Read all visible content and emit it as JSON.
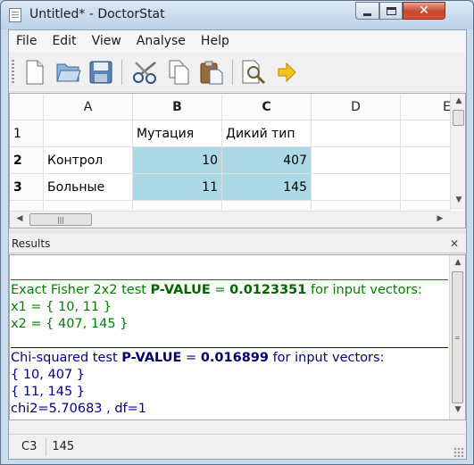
{
  "window": {
    "title": "Untitled* - DoctorStat",
    "close_glyph": "✕"
  },
  "menu": [
    "File",
    "Edit",
    "View",
    "Analyse",
    "Help"
  ],
  "toolbar": {
    "icons": [
      "new-document-icon",
      "open-folder-icon",
      "save-disk-icon",
      "cut-scissors-icon",
      "copy-icon",
      "paste-icon",
      "find-magnifier-icon",
      "run-arrow-icon"
    ]
  },
  "sheet": {
    "columns": [
      "A",
      "B",
      "C",
      "D",
      "E"
    ],
    "rows": [
      {
        "header": "1",
        "cells": [
          "",
          "Мутация",
          "Дикий тип",
          ""
        ]
      },
      {
        "header": "2",
        "cells": [
          "Контрол",
          "10",
          "407",
          ""
        ]
      },
      {
        "header": "3",
        "cells": [
          "Больные",
          "11",
          "145",
          ""
        ]
      }
    ],
    "selected_fill": "#add8e6"
  },
  "results": {
    "title": "Results",
    "fisher": {
      "prefix": "Exact Fisher 2x2 test ",
      "pvalue_label": "P-VALUE",
      "equals": " = ",
      "pvalue": "0.0123351",
      "suffix": " for input vectors:",
      "line2": "x1 = { 10, 11 }",
      "line3": "x2 = { 407, 145 }"
    },
    "chi": {
      "prefix": "Chi-squared test ",
      "pvalue_label": "P-VALUE",
      "equals": " = ",
      "pvalue": "0.016899",
      "suffix": " for input vectors:",
      "line2": "{ 10, 407 }",
      "line3": "{ 11, 145 }",
      "line4": "chi2=5.70683 , df=1"
    },
    "colors": {
      "fisher": "#008000",
      "chi": "#00008b"
    }
  },
  "status": {
    "cell_ref": "C3",
    "cell_value": "145"
  }
}
